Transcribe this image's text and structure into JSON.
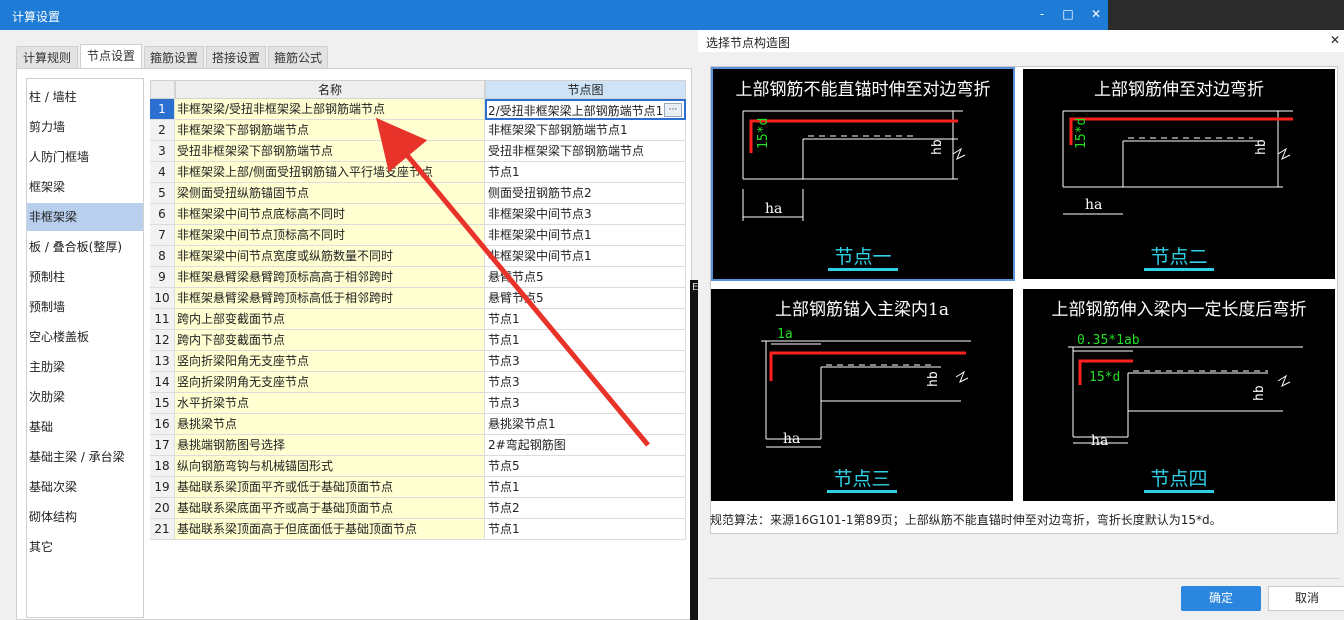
{
  "main": {
    "title": "计算设置",
    "window_buttons": [
      "-",
      "□",
      "✕"
    ]
  },
  "tabs": [
    "计算规则",
    "节点设置",
    "箍筋设置",
    "搭接设置",
    "箍筋公式"
  ],
  "active_tab": "节点设置",
  "categories": [
    "柱 / 墙柱",
    "剪力墙",
    "人防门框墙",
    "框架梁",
    "非框架梁",
    "板 / 叠合板(整厚)",
    "预制柱",
    "预制墙",
    "空心楼盖板",
    "主肋梁",
    "次肋梁",
    "基础",
    "基础主梁 / 承台梁",
    "基础次梁",
    "砌体结构",
    "其它"
  ],
  "selected_category": "非框架梁",
  "table": {
    "headers": {
      "name": "名称",
      "node": "节点图"
    },
    "rows": [
      {
        "num": "1",
        "name": "非框架梁/受扭非框架梁上部钢筋端节点",
        "node": "2/受扭非框架梁上部钢筋端节点1"
      },
      {
        "num": "2",
        "name": "非框架梁下部钢筋端节点",
        "node": "非框架梁下部钢筋端节点1"
      },
      {
        "num": "3",
        "name": "受扭非框架梁下部钢筋端节点",
        "node": "受扭非框架梁下部钢筋端节点"
      },
      {
        "num": "4",
        "name": "非框架梁上部/侧面受扭钢筋锚入平行墙支座节点",
        "node": "节点1"
      },
      {
        "num": "5",
        "name": "梁侧面受扭纵筋锚固节点",
        "node": "侧面受扭钢筋节点2"
      },
      {
        "num": "6",
        "name": "非框架梁中间节点底标高不同时",
        "node": "非框架梁中间节点3"
      },
      {
        "num": "7",
        "name": "非框架梁中间节点顶标高不同时",
        "node": "非框架梁中间节点1"
      },
      {
        "num": "8",
        "name": "非框架梁中间节点宽度或纵筋数量不同时",
        "node": "非框架梁中间节点1"
      },
      {
        "num": "9",
        "name": "非框架悬臂梁悬臂跨顶标高高于相邻跨时",
        "node": "悬臂节点5"
      },
      {
        "num": "10",
        "name": "非框架悬臂梁悬臂跨顶标高低于相邻跨时",
        "node": "悬臂节点5"
      },
      {
        "num": "11",
        "name": "跨内上部变截面节点",
        "node": "节点1"
      },
      {
        "num": "12",
        "name": "跨内下部变截面节点",
        "node": "节点1"
      },
      {
        "num": "13",
        "name": "竖向折梁阳角无支座节点",
        "node": "节点3"
      },
      {
        "num": "14",
        "name": "竖向折梁阴角无支座节点",
        "node": "节点3"
      },
      {
        "num": "15",
        "name": "水平折梁节点",
        "node": "节点3"
      },
      {
        "num": "16",
        "name": "悬挑梁节点",
        "node": "悬挑梁节点1"
      },
      {
        "num": "17",
        "name": "悬挑端钢筋图号选择",
        "node": "2#弯起钢筋图"
      },
      {
        "num": "18",
        "name": "纵向钢筋弯钩与机械锚固形式",
        "node": "节点5"
      },
      {
        "num": "19",
        "name": "基础联系梁顶面平齐或低于基础顶面节点",
        "node": "节点1"
      },
      {
        "num": "20",
        "name": "基础联系梁底面平齐或高于基础顶面节点",
        "node": "节点2"
      },
      {
        "num": "21",
        "name": "基础联系梁顶面高于但底面低于基础顶面节点",
        "node": "节点1"
      }
    ],
    "ellipsis_label": "···"
  },
  "side_letter": "E",
  "dialog": {
    "title": "选择节点构造图",
    "close_label": "✕",
    "panels": [
      {
        "title": "上部钢筋不能直锚时伸至对边弯折",
        "label": "节点一",
        "dims": [
          "15*d",
          "hb",
          "ha"
        ]
      },
      {
        "title": "上部钢筋伸至对边弯折",
        "label": "节点二",
        "dims": [
          "15*d",
          "hb",
          "ha"
        ]
      },
      {
        "title": "上部钢筋锚入主梁内1a",
        "label": "节点三",
        "dims": [
          "1a",
          "hb",
          "ha"
        ]
      },
      {
        "title": "上部钢筋伸入梁内一定长度后弯折",
        "label": "节点四",
        "dims": [
          "0.35*1ab",
          "15*d",
          "hb",
          "ha"
        ]
      }
    ],
    "selected_panel": "节点一",
    "description": "规范算法：来源16G101-1第89页；上部纵筋不能直锚时伸至对边弯折，弯折长度默认为15*d。",
    "ok_label": "确定",
    "cancel_label": "取消"
  },
  "colors": {
    "titlebar": "#1e7bd6",
    "selection": "#b8d0ee",
    "name_cell": "#ffffd2",
    "arrow": "#e8332a",
    "rebar": "#ff2020",
    "caption": "#2fd0e6"
  }
}
